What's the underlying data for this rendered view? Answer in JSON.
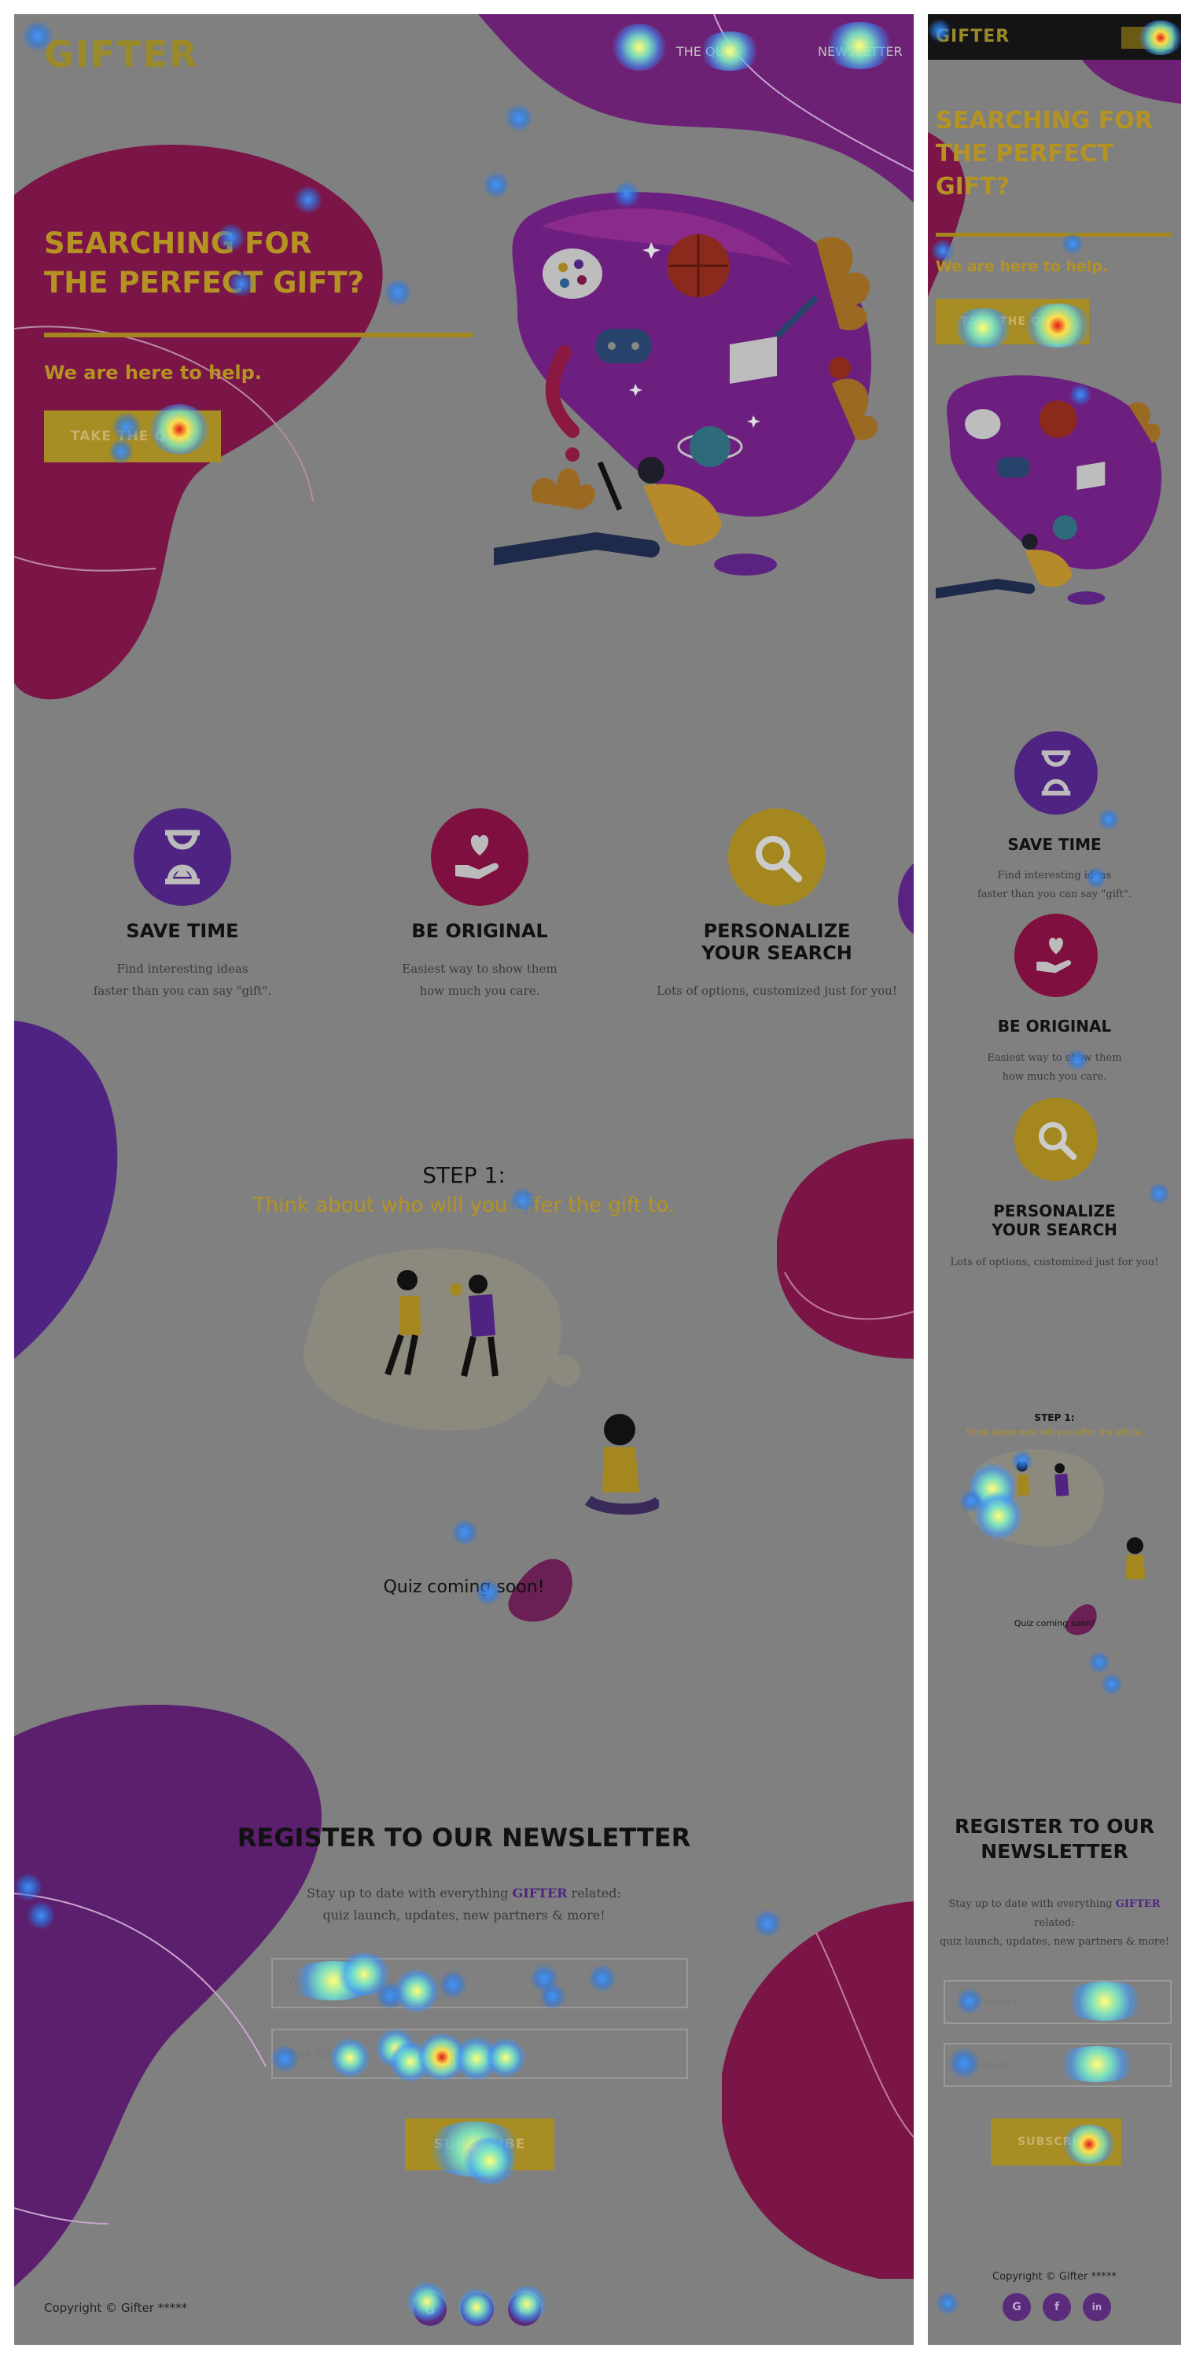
{
  "brand": {
    "logo": "GIFTER"
  },
  "nav": {
    "links": [
      "THE QUIZ",
      "NEWSLETTER"
    ]
  },
  "hero": {
    "title_line1": "SEARCHING FOR",
    "title_line2": "THE PERFECT GIFT?",
    "subtitle": "We are here to help.",
    "cta": "TAKE THE QUIZ"
  },
  "features": [
    {
      "title": "SAVE TIME",
      "line1": "Find interesting ideas",
      "line2": "faster than you can say \"gift\".",
      "icon": "hourglass-icon",
      "color": "#4e2381"
    },
    {
      "title": "BE ORIGINAL",
      "line1": "Easiest way to show them",
      "line2": "how much you care.",
      "icon": "heart-hand-icon",
      "color": "#7f0f3f"
    },
    {
      "title_line1": "PERSONALIZE",
      "title_line2": "YOUR SEARCH",
      "line1": "Lots of options, customized just for you!",
      "icon": "magnifier-icon",
      "color": "#a4871f"
    }
  ],
  "step": {
    "label": "STEP 1:",
    "text": "Think about who will you offer the gift to.",
    "coming": "Quiz coming soon!"
  },
  "newsletter": {
    "title": "REGISTER TO OUR NEWSLETTER",
    "title_line1": "REGISTER TO OUR",
    "title_line2": "NEWSLETTER",
    "desc_prefix": "Stay up to date with everything ",
    "desc_brand": "GIFTER",
    "desc_suffix": " related:",
    "desc_line2": "quiz launch, updates, new partners & more!",
    "name_placeholder": "Your Name *",
    "email_placeholder": "Your Email *",
    "button": "SUBSCRIBE"
  },
  "footer": {
    "copyright": "Copyright © Gifter *****",
    "social": [
      "G",
      "f",
      "in"
    ]
  },
  "colors": {
    "purple": "#4e2381",
    "magenta": "#7f0f3f",
    "gold": "#a4871f",
    "overlay": "#808080"
  }
}
